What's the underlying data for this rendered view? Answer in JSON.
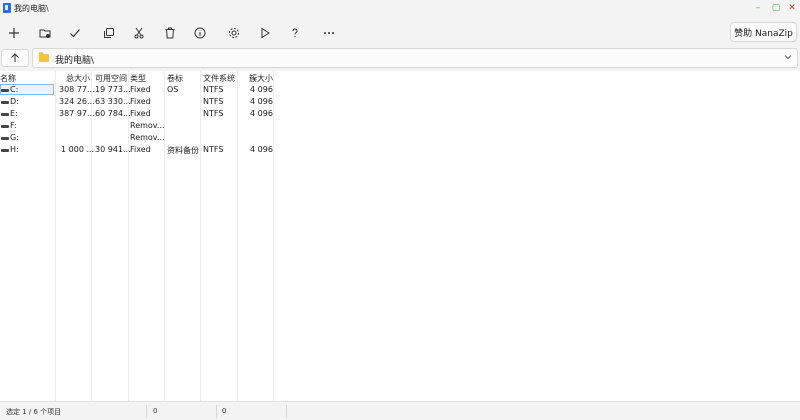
{
  "window": {
    "title": "我的电脑\\",
    "min_glyph": "–",
    "max_glyph": "▢",
    "close_glyph": "✕"
  },
  "toolbar": {
    "sponsor_label": "赞助 NanaZip",
    "icons": [
      "add-icon",
      "extract-icon",
      "test-icon",
      "copy-icon",
      "cut-icon",
      "delete-icon",
      "info-icon",
      "settings-icon",
      "run-icon",
      "help-icon",
      "more-icon"
    ]
  },
  "address": {
    "path": "我的电脑\\"
  },
  "list": {
    "headers": {
      "name": "名称",
      "total": "总大小",
      "free": "可用空间",
      "type": "类型",
      "label": "卷标",
      "fs": "文件系统",
      "cluster": "簇大小"
    },
    "rows": [
      {
        "name": "C:",
        "total": "308 77...",
        "free": "19 773...",
        "type": "Fixed",
        "label": "OS",
        "fs": "NTFS",
        "cluster": "4 096"
      },
      {
        "name": "D:",
        "total": "324 26...",
        "free": "63 330...",
        "type": "Fixed",
        "label": "",
        "fs": "NTFS",
        "cluster": "4 096"
      },
      {
        "name": "E:",
        "total": "387 97...",
        "free": "60 784...",
        "type": "Fixed",
        "label": "",
        "fs": "NTFS",
        "cluster": "4 096"
      },
      {
        "name": "F:",
        "total": "",
        "free": "",
        "type": "Remov...",
        "label": "",
        "fs": "",
        "cluster": ""
      },
      {
        "name": "G:",
        "total": "",
        "free": "",
        "type": "Remov...",
        "label": "",
        "fs": "",
        "cluster": ""
      },
      {
        "name": "H:",
        "total": "1 000 ...",
        "free": "30 941...",
        "type": "Fixed",
        "label": "资料备份",
        "fs": "NTFS",
        "cluster": "4 096"
      }
    ]
  },
  "status": {
    "selection": "选定 1 / 6 个项目",
    "size1": "0",
    "size2": "0"
  },
  "colors": {
    "accent": "#2b6fd6",
    "selection_border": "#8fb6e8",
    "folder": "#f5c242"
  }
}
